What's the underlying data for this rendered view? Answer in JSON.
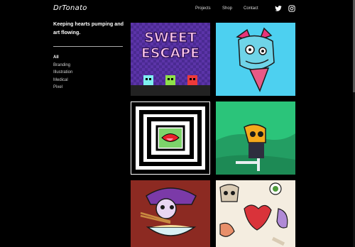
{
  "brand": {
    "logo_text": "DrTonato"
  },
  "nav": {
    "projects": "Projects",
    "shop": "Shop",
    "contact": "Contact"
  },
  "social": {
    "icons": [
      "twitter-icon",
      "instagram-icon"
    ]
  },
  "intro": {
    "tagline": "Keeping hearts pumping and art flowing."
  },
  "filters": [
    "All",
    "Branding",
    "Illustration",
    "Medical",
    "Pixel"
  ],
  "filters_active": "All",
  "tiles": [
    {
      "text": "SWEET ESCAPE"
    }
  ],
  "colors": {
    "background": "#000000",
    "tile1": "#5a2fa8",
    "tile2": "#4dd0f0",
    "tile4": "#2bc47a",
    "tile5": "#8c2a22",
    "tile6": "#f4ede0"
  }
}
